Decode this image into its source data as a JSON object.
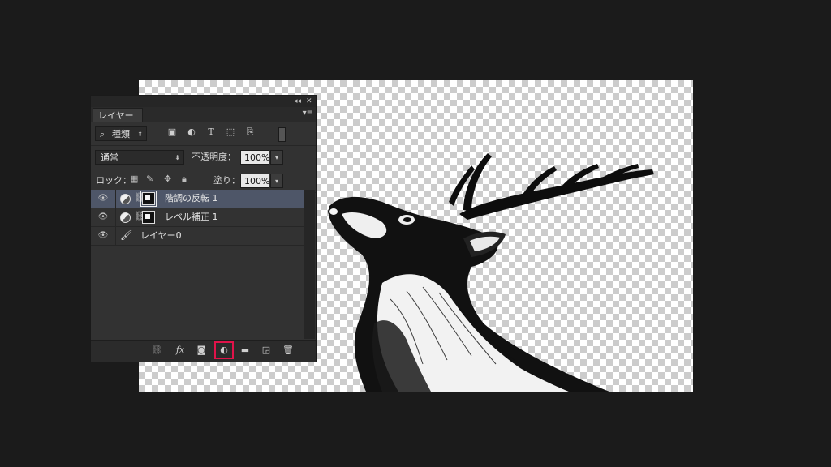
{
  "panel": {
    "tab_label": "レイヤー",
    "collapse_glyph": "◂◂",
    "close_glyph": "✕",
    "menu_glyph": "▾≡"
  },
  "filter": {
    "search_glyph": "⌕",
    "kind_label": "種類",
    "arrow": "⬍",
    "icons": [
      "image-filter-icon",
      "adjustment-filter-icon",
      "type-filter-icon",
      "shape-filter-icon",
      "smart-object-filter-icon",
      "filter-toggle-icon"
    ]
  },
  "blend": {
    "mode": "通常",
    "opacity_label": "不透明度：",
    "opacity_value": "100%"
  },
  "lock": {
    "label": "ロック：",
    "fill_label": "塗り：",
    "fill_value": "100%"
  },
  "layers": [
    {
      "name": "階調の反転 1",
      "type": "adjustment",
      "selected": true,
      "visible": true
    },
    {
      "name": "レベル補正 1",
      "type": "adjustment",
      "selected": false,
      "visible": true
    },
    {
      "name": "レイヤー0",
      "type": "pixel",
      "selected": false,
      "visible": true
    }
  ],
  "bottom_bar": {
    "icons": [
      "link-layers-icon",
      "fx-icon",
      "add-mask-icon",
      "new-adjustment-layer-icon",
      "new-group-icon",
      "new-layer-icon",
      "delete-layer-icon"
    ],
    "fx_label": "fx",
    "highlight_color": "#e0134a"
  },
  "colors": {
    "panel_bg": "#323232",
    "selected_row": "#4e5668",
    "app_bg": "#1b1b1b"
  }
}
